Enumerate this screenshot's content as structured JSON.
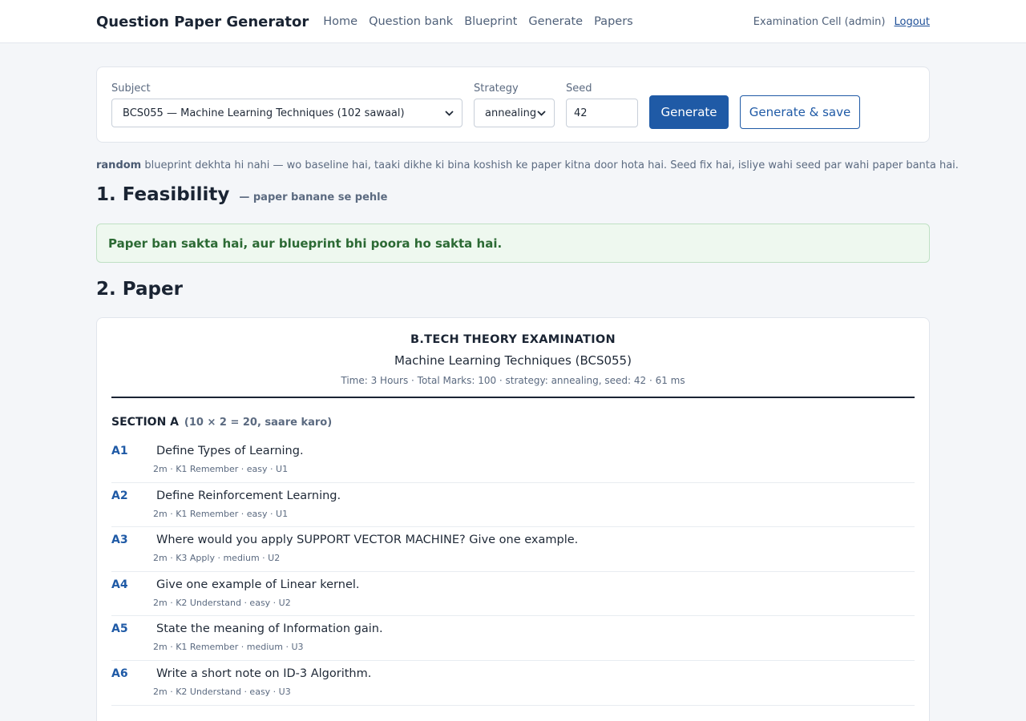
{
  "app": {
    "brand": "Question Paper Generator",
    "nav": [
      "Home",
      "Question bank",
      "Blueprint",
      "Generate",
      "Papers"
    ],
    "user": "Examination Cell (admin)",
    "logout": "Logout"
  },
  "controls": {
    "subject_label": "Subject",
    "subject_value": "BCS055 — Machine Learning Techniques (102 sawaal)",
    "strategy_label": "Strategy",
    "strategy_value": "annealing",
    "seed_label": "Seed",
    "seed_value": "42",
    "generate": "Generate",
    "generate_save": "Generate & save"
  },
  "note": {
    "bold": "random",
    "text": " blueprint dekhta hi nahi — wo baseline hai, taaki dikhe ki bina koshish ke paper kitna door hota hai. Seed fix hai, isliye wahi seed par wahi paper banta hai."
  },
  "feasibility": {
    "heading": "1. Feasibility",
    "sub": "— paper banane se pehle",
    "message": "Paper ban sakta hai, aur blueprint bhi poora ho sakta hai."
  },
  "paper": {
    "heading": "2. Paper",
    "exam_title": "B.TECH THEORY EXAMINATION",
    "subject": "Machine Learning Techniques (BCS055)",
    "meta": "Time: 3 Hours  ·  Total Marks: 100  ·  strategy: annealing, seed: 42  ·  61 ms",
    "section_title": "SECTION A",
    "section_note": "(10 × 2 = 20, saare karo)",
    "questions": [
      {
        "num": "A1",
        "text": "Define Types of Learning.",
        "meta": "2m · K1 Remember · easy · U1"
      },
      {
        "num": "A2",
        "text": "Define Reinforcement Learning.",
        "meta": "2m · K1 Remember · easy · U1"
      },
      {
        "num": "A3",
        "text": "Where would you apply SUPPORT VECTOR MACHINE? Give one example.",
        "meta": "2m · K3 Apply · medium · U2"
      },
      {
        "num": "A4",
        "text": "Give one example of Linear kernel.",
        "meta": "2m · K2 Understand · easy · U2"
      },
      {
        "num": "A5",
        "text": "State the meaning of Information gain.",
        "meta": "2m · K1 Remember · medium · U3"
      },
      {
        "num": "A6",
        "text": "Write a short note on ID-3 Algorithm.",
        "meta": "2m · K2 Understand · easy · U3"
      }
    ]
  },
  "colors": {
    "accent": "#1f5aa6",
    "success_bg": "#eef8ef",
    "success_text": "#2c6a34"
  },
  "icons": {
    "select_chevron": "chevron-down-icon"
  }
}
